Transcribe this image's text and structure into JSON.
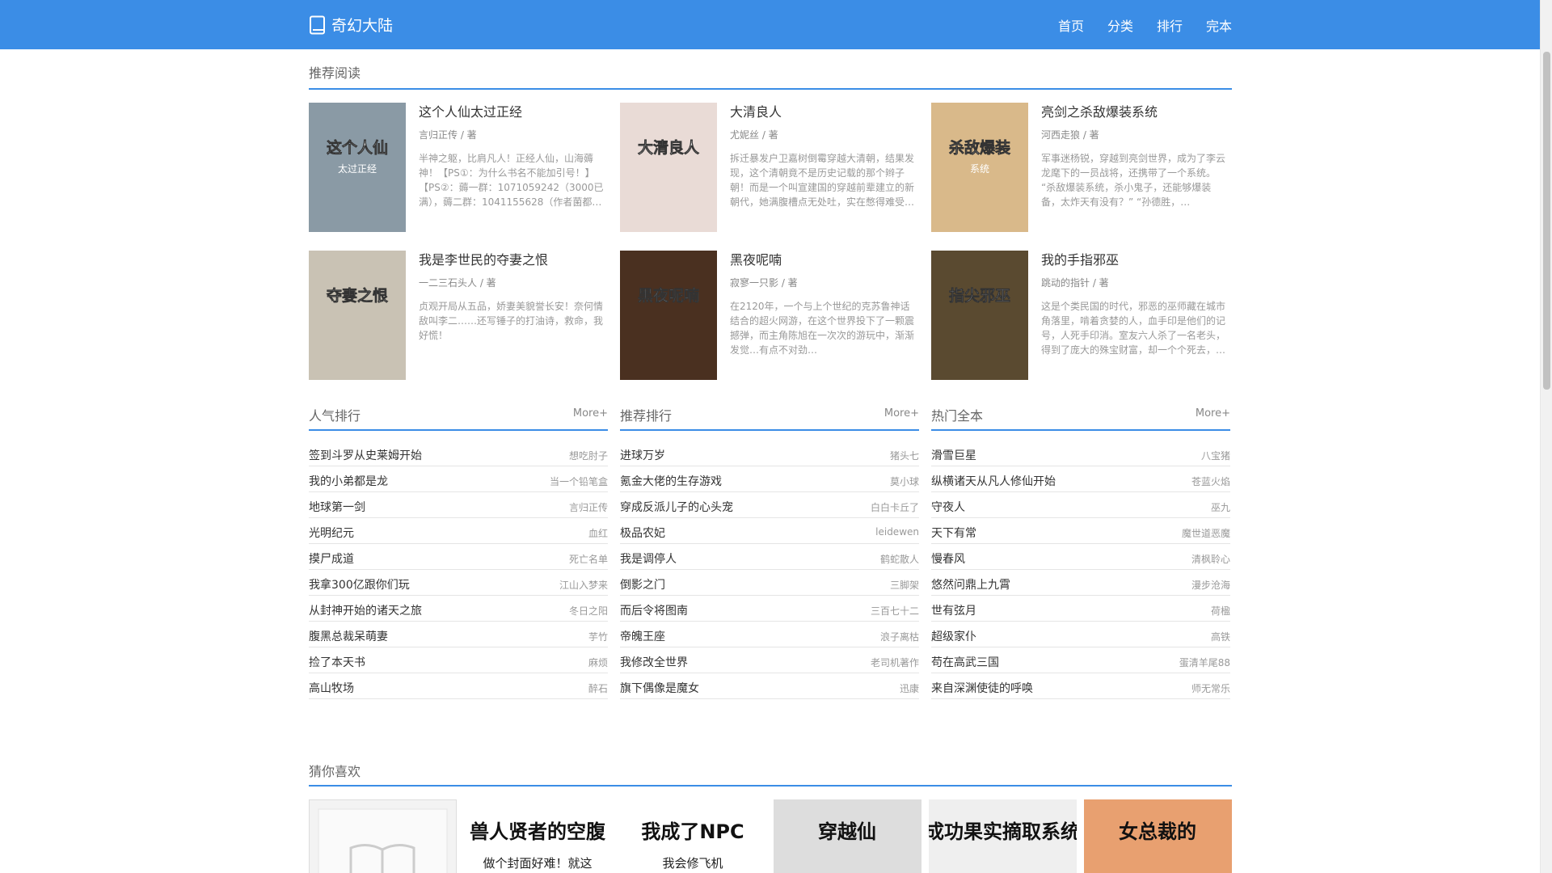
{
  "site": {
    "name": "奇幻大陆",
    "logo_icon": "book-icon"
  },
  "nav": [
    {
      "label": "首页"
    },
    {
      "label": "分类"
    },
    {
      "label": "排行"
    },
    {
      "label": "完本"
    }
  ],
  "recommend": {
    "title": "推荐阅读",
    "books": [
      {
        "title": "这个人仙太过正经",
        "author": "言归正传 / 著",
        "cover_text": "这个人仙",
        "cover_sub": "太过正经",
        "cover_bg": "#8a9aa5",
        "desc": "半神之躯，比肩凡人！正经人仙，山海薅神！【PS①：为什么书名不能加引号！】【PS②：薅一群：1071059242（3000已满），薅二群：1041155628（作者菌都…"
      },
      {
        "title": "大清良人",
        "author": "尤妮丝 / 著",
        "cover_text": "大清良人",
        "cover_sub": "",
        "cover_bg": "#e9dbd6",
        "desc": "拆迁暴发户卫嘉树倒霉穿越大清朝，结果发现，这个清朝竟不是历史记载的那个辫子朝！而是一个叫宣建国的穿越前辈建立的新朝代，她满腹槽点无处吐，实在憋得难受…"
      },
      {
        "title": "亮剑之杀敌爆装系统",
        "author": "河西走狼 / 著",
        "cover_text": "杀敌爆装",
        "cover_sub": "系统",
        "cover_bg": "#d9b98a",
        "desc": "军事迷杨锐，穿越到亮剑世界，成为了李云龙麾下的一员战将，还携带了一个系统。 “杀敌爆装系统，杀小鬼子，还能够爆装备，太炸天有没有？” “孙德胜，…"
      },
      {
        "title": "我是李世民的夺妻之恨",
        "author": "一二三石头人 / 著",
        "cover_text": "夺妻之恨",
        "cover_sub": "",
        "cover_bg": "#c9c2b4",
        "desc": "贞观开局从五品，娇妻美貌誉长安！奈何情敌叫李二……还写锤子的打油诗，救命，我好慌！"
      },
      {
        "title": "黑夜呢喃",
        "author": "寂寥一只影 / 著",
        "cover_text": "黑夜呢喃",
        "cover_sub": "",
        "cover_bg": "#4a3020",
        "desc": "在2120年，一个与上个世纪的克苏鲁神话结合的超火网游，在这个世界投下了一颗震撼弹，而主角陈旭在一次次的游玩中，渐渐发觉…有点不对劲…"
      },
      {
        "title": "我的手指邪巫",
        "author": "跳动的指针 / 著",
        "cover_text": "指尖邪巫",
        "cover_sub": "",
        "cover_bg": "#5a4a30",
        "desc": "这是个类民国的时代，邪恶的巫师藏在城市角落里，啃着贪婪的人，血手印是他们的记号，人死手印消。室友六人杀了一名老头，得到了庞大的殊宝财富，却一个个死去，…"
      }
    ]
  },
  "ranks": [
    {
      "title": "人气排行",
      "more": "More+",
      "items": [
        {
          "name": "签到斗罗从史莱姆开始",
          "author": "想吃肘子"
        },
        {
          "name": "我的小弟都是龙",
          "author": "当一个铅笔盒"
        },
        {
          "name": "地球第一剑",
          "author": "言归正传"
        },
        {
          "name": "光明纪元",
          "author": "血红"
        },
        {
          "name": "摸尸成道",
          "author": "死亡名单"
        },
        {
          "name": "我拿300亿跟你们玩",
          "author": "江山入梦来"
        },
        {
          "name": "从封神开始的诸天之旅",
          "author": "冬日之阳"
        },
        {
          "name": "腹黑总裁呆萌妻",
          "author": "芋竹"
        },
        {
          "name": "捡了本天书",
          "author": "麻烦"
        },
        {
          "name": "高山牧场",
          "author": "醉石"
        }
      ]
    },
    {
      "title": "推荐排行",
      "more": "More+",
      "items": [
        {
          "name": "进球万岁",
          "author": "猪头七"
        },
        {
          "name": "氪金大佬的生存游戏",
          "author": "莫小球"
        },
        {
          "name": "穿成反派儿子的心头宠",
          "author": "白白卡丘了"
        },
        {
          "name": "极品农妃",
          "author": "leidewen"
        },
        {
          "name": "我是调停人",
          "author": "鹤蛇散人"
        },
        {
          "name": "倒影之门",
          "author": "三脚架"
        },
        {
          "name": "而后令将图南",
          "author": "三百七十二"
        },
        {
          "name": "帝魄王座",
          "author": "浪子离枯"
        },
        {
          "name": "我修改全世界",
          "author": "老司机著作"
        },
        {
          "name": "旗下偶像是魔女",
          "author": "迅康"
        }
      ]
    },
    {
      "title": "热门全本",
      "more": "More+",
      "items": [
        {
          "name": "滑雪巨星",
          "author": "八宝猪"
        },
        {
          "name": "纵横诸天从凡人修仙开始",
          "author": "苍蓝火焰"
        },
        {
          "name": "守夜人",
          "author": "巫九"
        },
        {
          "name": "天下有常",
          "author": "魔世道恶魔"
        },
        {
          "name": "慢春风",
          "author": "清枫聆心"
        },
        {
          "name": "悠然问鼎上九霄",
          "author": "漫步沧海"
        },
        {
          "name": "世有弦月",
          "author": "荷楹"
        },
        {
          "name": "超级家仆",
          "author": "高铁"
        },
        {
          "name": "苟在高武三国",
          "author": "蛋清羊尾88"
        },
        {
          "name": "来自深渊使徒的呼唤",
          "author": "师无常乐"
        }
      ]
    }
  ],
  "guess": {
    "title": "猜你喜欢",
    "covers": [
      {
        "text": "",
        "bg": "#f2f2f2",
        "placeholder": true
      },
      {
        "text": "兽人贤者的空腹",
        "sub": "做个封面好难！就这",
        "bg": "#ffffff"
      },
      {
        "text": "我成了NPC",
        "sub": "我会修飞机",
        "bg": "#ffffff"
      },
      {
        "text": "穿越仙",
        "sub": "",
        "bg": "#dddddd"
      },
      {
        "text": "成功果实摘取系统",
        "sub": "",
        "bg": "#efefef"
      },
      {
        "text": "女总裁的",
        "sub": "",
        "bg": "#e8a070"
      }
    ]
  }
}
